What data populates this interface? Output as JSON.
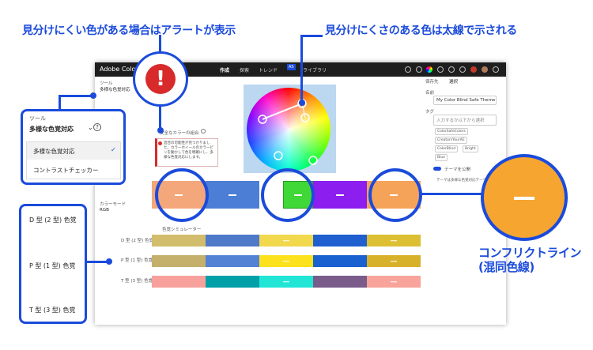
{
  "callouts": {
    "left_title": "見分けにくい色がある場合はアラートが表示",
    "right_title": "見分けにくさのある色は太線で示される",
    "conflict_line": "コンフリクトライン",
    "conflict_line_sub": "(混同色線)"
  },
  "app": {
    "brand": "Adobe Color",
    "tabs": [
      "作成",
      "探索",
      "トレンド",
      "ライブラリ"
    ],
    "tab_badge": "AS",
    "tools_label": "ツール",
    "tools_value": "多様な色覚対応",
    "alert_heading": "安全なカラーの組合",
    "alert_text": "混合の可能性が見つかりました。カラーホイールのカラーピンを動かして色を明確にし、多様な色覚対応にします。",
    "color_mode_label": "カラーモード",
    "color_mode_value": "RGB",
    "sim_label": "色覚シミュレーター",
    "sim_rows": [
      "D 型 (2 型) 色覚",
      "P 型 (1 型) 色覚",
      "T 型 (3 型) 色覚"
    ],
    "right_panel": {
      "save_label": "保存先",
      "save_value": "選択",
      "name_label": "名前",
      "name_value": "My Color Blind Safe Theme",
      "tag_label": "タグ",
      "tag_placeholder": "入力するか以下から選択",
      "tags": [
        "ColorSafeColors",
        "CreatorsYourAE",
        "ColorBlind",
        "Bright",
        "Blue"
      ],
      "publish_label": "テーマを公開",
      "note": "テーマは多様な色覚対応テーマです。"
    }
  },
  "tools_panel": {
    "label": "ツール",
    "selected": "多様な色覚対応",
    "options": [
      "多様な色覚対応",
      "コントラストチェッカー"
    ]
  },
  "vision_panel": {
    "rows": [
      "D 型 (2 型) 色覚",
      "P 型 (1 型) 色覚",
      "T 型 (3 型) 色覚"
    ]
  },
  "colors": {
    "main": [
      "#f4a77a",
      "#4c7ed6",
      "#3fd836",
      "#8c1ef0",
      "#f6a35a"
    ],
    "sim_d": [
      "#d2bd6d",
      "#4f79c9",
      "#f1d84c",
      "#1f5fcf",
      "#ddbf33"
    ],
    "sim_p": [
      "#c5b06b",
      "#5382d4",
      "#fce21d",
      "#1960d0",
      "#d8b12a"
    ],
    "sim_t": [
      "#f8a19c",
      "#00a0a8",
      "#21e6d6",
      "#7a5c8a",
      "#f8a49b"
    ],
    "accent": "#1b4bdb",
    "alert": "#d82a2a"
  }
}
